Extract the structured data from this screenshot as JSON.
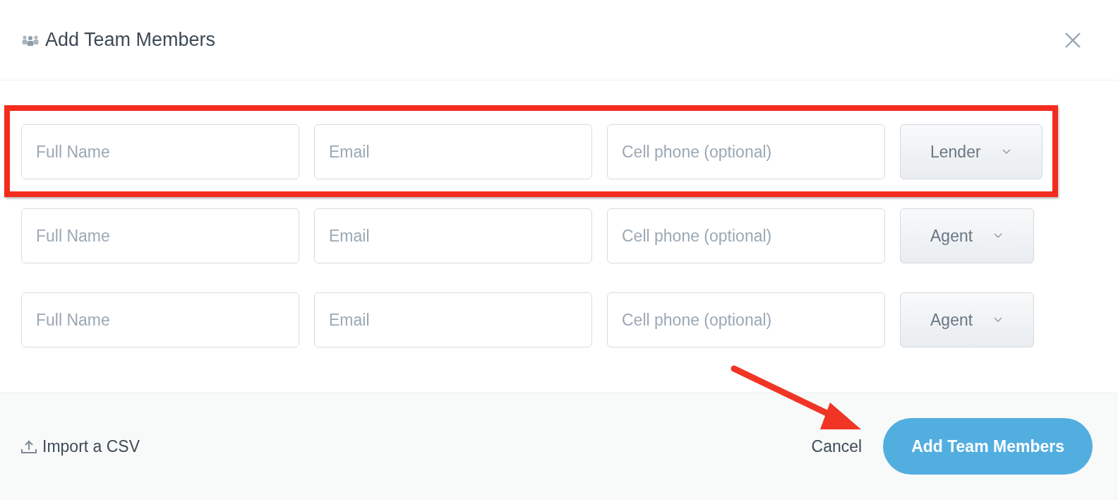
{
  "dialog": {
    "title": "Add Team Members"
  },
  "rows": [
    {
      "name_placeholder": "Full Name",
      "email_placeholder": "Email",
      "phone_placeholder": "Cell phone (optional)",
      "role": "Lender",
      "highlighted": true
    },
    {
      "name_placeholder": "Full Name",
      "email_placeholder": "Email",
      "phone_placeholder": "Cell phone (optional)",
      "role": "Agent",
      "highlighted": false
    },
    {
      "name_placeholder": "Full Name",
      "email_placeholder": "Email",
      "phone_placeholder": "Cell phone (optional)",
      "role": "Agent",
      "highlighted": false
    }
  ],
  "footer": {
    "import_link": "Import a CSV",
    "cancel": "Cancel",
    "submit": "Add Team Members"
  }
}
